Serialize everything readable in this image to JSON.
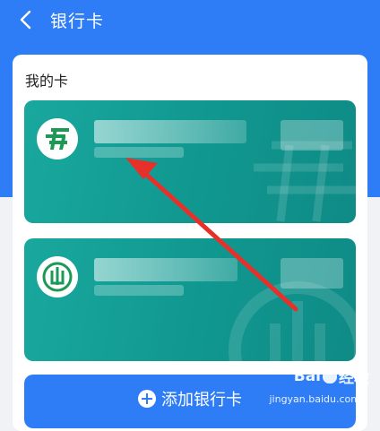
{
  "header": {
    "title": "银行卡",
    "back_icon": "chevron-left-icon"
  },
  "main": {
    "section_title": "我的卡",
    "cards": [
      {
        "logo": "postal-savings-bank-logo",
        "color": "#13a096"
      },
      {
        "logo": "agricultural-bank-logo",
        "color": "#13a096"
      }
    ],
    "add_button_label": "添加银行卡",
    "add_icon": "plus-circle-icon"
  },
  "watermark": {
    "brand_prefix": "Bai",
    "brand_suffix": "经验",
    "url": "jingyan.baidu.com"
  },
  "colors": {
    "primary": "#2f7df6",
    "card": "#13a096",
    "annotation_arrow": "#e8302b"
  }
}
